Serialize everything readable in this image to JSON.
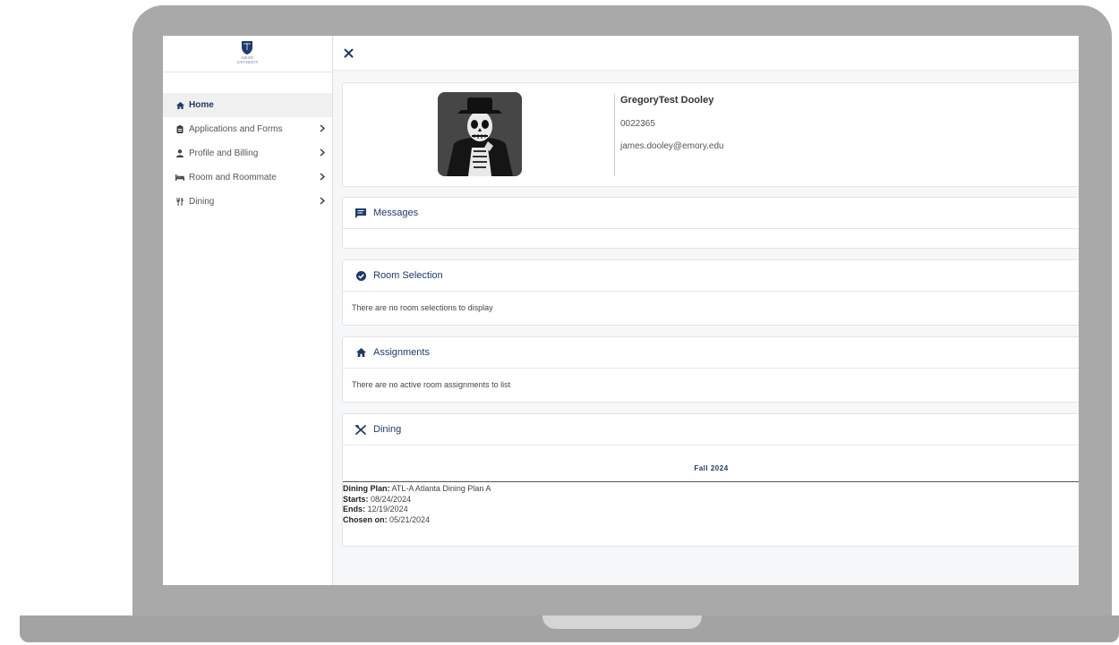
{
  "sidebar": {
    "items": [
      {
        "label": "Home",
        "icon": "home-icon",
        "active": true
      },
      {
        "label": "Applications and Forms",
        "icon": "clipboard-icon",
        "has_submenu": true
      },
      {
        "label": "Profile and Billing",
        "icon": "user-icon",
        "has_submenu": true
      },
      {
        "label": "Room and Roommate",
        "icon": "bed-icon",
        "has_submenu": true
      },
      {
        "label": "Dining",
        "icon": "utensils-icon",
        "has_submenu": true
      }
    ]
  },
  "topbar": {
    "close_icon": "close-icon"
  },
  "profile": {
    "name": "GregoryTest Dooley",
    "id": "0022365",
    "email": "james.dooley@emory.edu"
  },
  "messages": {
    "title": "Messages",
    "icon": "message-icon"
  },
  "room_selection": {
    "title": "Room Selection",
    "icon": "check-circle-icon",
    "empty_text": "There are no room selections to display"
  },
  "assignments": {
    "title": "Assignments",
    "icon": "home-icon",
    "empty_text": "There are no active room assignments to list"
  },
  "dining": {
    "title": "Dining",
    "icon": "crossed-utensils-icon",
    "term": "Fall 2024",
    "plan_label": "Dining Plan:",
    "plan_value": "ATL-A Atlanta Dining Plan A",
    "starts_label": "Starts:",
    "starts_value": "08/24/2024",
    "ends_label": "Ends:",
    "ends_value": "12/19/2024",
    "chosen_label": "Chosen on:",
    "chosen_value": "05/21/2024"
  },
  "colors": {
    "brand": "#1f3a6b",
    "frame": "#a9a9a9",
    "content_bg": "#f6f7f8"
  }
}
